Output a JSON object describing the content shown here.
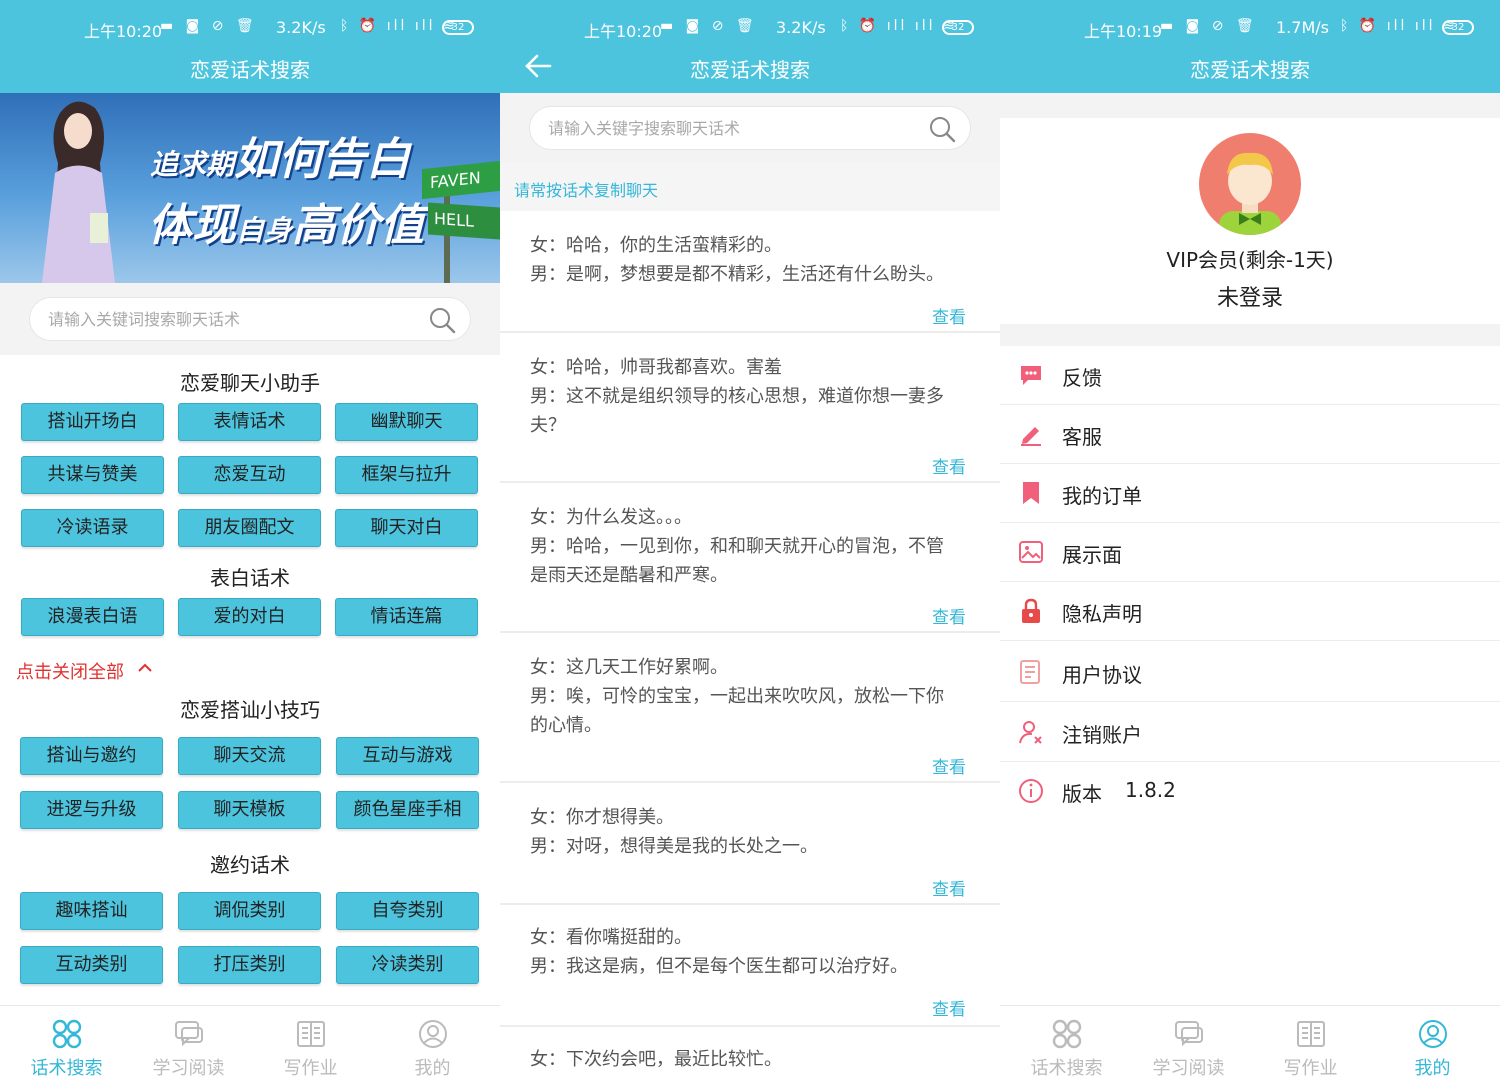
{
  "status_bars": [
    {
      "time": "上午10:20",
      "speed": "3.2K/s",
      "battery": "32"
    },
    {
      "time": "上午10:20",
      "speed": "3.2K/s",
      "battery": "32"
    },
    {
      "time": "上午10:19",
      "speed": "1.7M/s",
      "battery": "32"
    }
  ],
  "app_title": "恋爱话术搜索",
  "search_placeholder_home": "请输入关键词搜索聊天话术",
  "search_placeholder_list": "请输入关键字搜索聊天话术",
  "banner": {
    "line1_small": "追求期",
    "line1_big": "如何告白",
    "line2_big1": "体现",
    "line2_small": "自身",
    "line2_big2": "高价值",
    "sign_top": "FAVEN",
    "sign_bottom": "HELL"
  },
  "home": {
    "sections": [
      {
        "title": "恋爱聊天小助手",
        "buttons": [
          "搭讪开场白",
          "表情话术",
          "幽默聊天",
          "共谋与赞美",
          "恋爱互动",
          "框架与拉升",
          "冷读语录",
          "朋友圈配文",
          "聊天对白"
        ]
      },
      {
        "title": "表白话术",
        "buttons": [
          "浪漫表白语",
          "爱的对白",
          "情话连篇"
        ]
      },
      {
        "title": "恋爱搭讪小技巧",
        "buttons": [
          "搭讪与邀约",
          "聊天交流",
          "互动与游戏",
          "进逻与升级",
          "聊天模板",
          "颜色星座手相"
        ]
      },
      {
        "title": "邀约话术",
        "buttons": [
          "趣味搭讪",
          "调侃类别",
          "自夸类别",
          "互动类别",
          "打压类别",
          "冷读类别"
        ]
      }
    ],
    "collapse_label": "点击关闭全部"
  },
  "list": {
    "hint": "请常按话术复制聊天",
    "view_label": "查看",
    "cards": [
      {
        "lines": [
          "女：哈哈，你的生活蛮精彩的。",
          "男：是啊，梦想要是都不精彩，生活还有什么盼头。"
        ]
      },
      {
        "lines": [
          "女：哈哈，帅哥我都喜欢。害羞",
          "男：这不就是组织领导的核心思想，难道你想一妻多",
          "夫？"
        ]
      },
      {
        "lines": [
          "女：为什么发这。。。",
          "男：哈哈，一见到你，和和聊天就开心的冒泡，不管",
          "是雨天还是酷暑和严寒。"
        ]
      },
      {
        "lines": [
          "女：这几天工作好累啊。",
          "男：唉，可怜的宝宝，一起出来吹吹风，放松一下你",
          "的心情。"
        ]
      },
      {
        "lines": [
          "女：你才想得美。",
          "男：对呀，想得美是我的长处之一。"
        ]
      },
      {
        "lines": [
          "女：看你嘴挺甜的。",
          "男：我这是病，但不是每个医生都可以治疗好。"
        ]
      },
      {
        "lines": [
          "女：下次约会吧，最近比较忙。"
        ]
      }
    ]
  },
  "profile": {
    "vip": "VIP会员(剩余-1天)",
    "login": "未登录",
    "menu": [
      {
        "label": "反馈",
        "icon": "chat-bubble-icon",
        "color": "#f0607a"
      },
      {
        "label": "客服",
        "icon": "pencil-icon",
        "color": "#f0607a"
      },
      {
        "label": "我的订单",
        "icon": "bookmark-icon",
        "color": "#f0607a"
      },
      {
        "label": "展示面",
        "icon": "image-icon",
        "color": "#f0607a"
      },
      {
        "label": "隐私声明",
        "icon": "lock-icon",
        "color": "#e84a4a"
      },
      {
        "label": "用户协议",
        "icon": "document-icon",
        "color": "#f0a0a0"
      },
      {
        "label": "注销账户",
        "icon": "user-remove-icon",
        "color": "#f0607a"
      },
      {
        "label": "版本",
        "icon": "info-icon",
        "color": "#f0607a",
        "value": "1.8.2"
      }
    ]
  },
  "nav": [
    {
      "label": "话术搜索",
      "icon": "grid-icon"
    },
    {
      "label": "学习阅读",
      "icon": "chat-icon"
    },
    {
      "label": "写作业",
      "icon": "book-icon"
    },
    {
      "label": "我的",
      "icon": "profile-icon"
    }
  ],
  "colors": {
    "primary": "#4cc4de",
    "nav_active": "#35b7d8",
    "nav_inactive": "#bbbbbb",
    "collapse_red": "#e0322f",
    "avatar_bg": "#f07e6e"
  }
}
